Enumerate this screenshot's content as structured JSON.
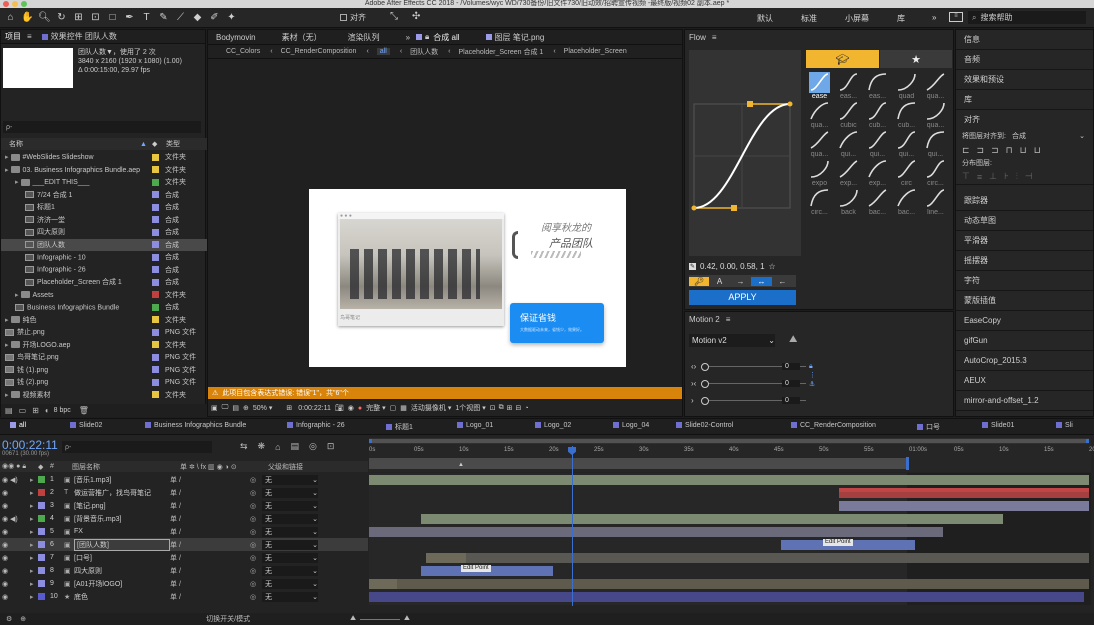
{
  "window": {
    "title": "Adobe After Effects CC 2018 - /Volumes/wyc WD/730备份/旧文件730/旧动效/招聘宣传视频 -最终版/视频02 副本.aep *"
  },
  "toolbar": {
    "align_label": "对齐",
    "workspaces": [
      "默认",
      "标准",
      "小屏幕",
      "库"
    ],
    "more": "»",
    "search_placeholder": "搜索帮助"
  },
  "project": {
    "tab": "项目",
    "effects_tab": "效果控件 团队人数",
    "comp_name": "团队人数▼，使用了 2 次",
    "comp_res": "3840 x 2160 (1920 x 1080) (1.00)",
    "comp_dur": "Δ 0:00:15:00, 29.97 fps",
    "search": "ρ-",
    "col_name": "名称",
    "col_type": "类型",
    "bpc": "8 bpc",
    "rows": [
      {
        "name": "#WebSlides Slideshow",
        "type": "文件夹",
        "color": "#e6c640",
        "kind": "folder",
        "indent": 0
      },
      {
        "name": "03. Business Infographics Bundle.aep",
        "type": "文件夹",
        "color": "#e6c640",
        "kind": "folder",
        "indent": 0
      },
      {
        "name": "___EDIT THIS___",
        "type": "文件夹",
        "color": "#4ea84e",
        "kind": "folder",
        "indent": 1
      },
      {
        "name": "7/24 合成 1",
        "type": "合成",
        "color": "#8d8de0",
        "kind": "comp",
        "indent": 2
      },
      {
        "name": "标题1",
        "type": "合成",
        "color": "#8d8de0",
        "kind": "comp",
        "indent": 2
      },
      {
        "name": "济济一堂",
        "type": "合成",
        "color": "#8d8de0",
        "kind": "comp",
        "indent": 2
      },
      {
        "name": "四大原则",
        "type": "合成",
        "color": "#8d8de0",
        "kind": "comp",
        "indent": 2
      },
      {
        "name": "团队人数",
        "type": "合成",
        "color": "#8d8de0",
        "kind": "comp",
        "indent": 2,
        "selected": true
      },
      {
        "name": "Infographic - 10",
        "type": "合成",
        "color": "#8d8de0",
        "kind": "comp",
        "indent": 2
      },
      {
        "name": "Infographic - 26",
        "type": "合成",
        "color": "#8d8de0",
        "kind": "comp",
        "indent": 2
      },
      {
        "name": "Placeholder_Screen 合成 1",
        "type": "合成",
        "color": "#8d8de0",
        "kind": "comp",
        "indent": 2
      },
      {
        "name": "Assets",
        "type": "文件夹",
        "color": "#c04040",
        "kind": "folder",
        "indent": 1
      },
      {
        "name": "Business Infographics Bundle",
        "type": "合成",
        "color": "#4ea84e",
        "kind": "comp",
        "indent": 1
      },
      {
        "name": "纯色",
        "type": "文件夹",
        "color": "#e6c640",
        "kind": "folder",
        "indent": 0
      },
      {
        "name": "禁止.png",
        "type": "PNG 文件",
        "color": "#8d8de0",
        "kind": "file",
        "indent": 0
      },
      {
        "name": "开场LOGO.aep",
        "type": "文件夹",
        "color": "#e6c640",
        "kind": "folder",
        "indent": 0
      },
      {
        "name": "鸟哥笔记.png",
        "type": "PNG 文件",
        "color": "#8d8de0",
        "kind": "file",
        "indent": 0
      },
      {
        "name": "钱 (1).png",
        "type": "PNG 文件",
        "color": "#8d8de0",
        "kind": "file",
        "indent": 0
      },
      {
        "name": "钱 (2).png",
        "type": "PNG 文件",
        "color": "#8d8de0",
        "kind": "file",
        "indent": 0
      },
      {
        "name": "视频素材",
        "type": "文件夹",
        "color": "#e6c640",
        "kind": "folder",
        "indent": 0
      }
    ]
  },
  "viewer": {
    "tabs": [
      "Bodymovin",
      "素材（无）",
      "渲染队列",
      "合成 all",
      "图层 笔记.png"
    ],
    "breadcrumbs": [
      "CC_Colors",
      "CC_RenderComposition",
      "all",
      "团队人数",
      "Placeholder_Screen 合成 1",
      "Placeholder_Screen"
    ],
    "slide_title": "保证省钱",
    "slide_sub": "大数据驱动未来，省钱少，效果好。",
    "slide_hand1": "阅享秋龙的",
    "slide_hand2": "产品团队",
    "slide_caption": "鸟哥笔记",
    "error": "此项目包含表达式错误: 错误\"1\"，共\"6\"个",
    "zoom": "50%",
    "time": "0:00:22:11",
    "quality": "完整",
    "camera": "活动摄像机",
    "views": "1个视图"
  },
  "flow": {
    "title": "Flow",
    "values": "0.42, 0.00, 0.58, 1",
    "apply": "APPLY",
    "easings": [
      "ease",
      "eas...",
      "eas...",
      "quad",
      "qua...",
      "qua...",
      "cubic",
      "cub...",
      "cub...",
      "qua...",
      "qua...",
      "qui...",
      "qui...",
      "qui...",
      "qui...",
      "expo",
      "exp...",
      "exp...",
      "circ",
      "circ...",
      "circ...",
      "back",
      "bac...",
      "bac...",
      "line..."
    ]
  },
  "motion2": {
    "title": "Motion 2",
    "version": "Motion v2",
    "values": [
      "0",
      "0",
      "0"
    ]
  },
  "right_panel": {
    "items": [
      "信息",
      "音频",
      "效果和预设",
      "库",
      "对齐"
    ],
    "align_to_label": "将图层对齐到:",
    "align_to": "合成",
    "distribute": "分布图层:",
    "plugins": [
      "跟踪器",
      "动态草图",
      "平滑器",
      "摇摆器",
      "字符",
      "蒙版插值",
      "EaseCopy",
      "gifGun",
      "AutoCrop_2015.3",
      "AEUX",
      "mirror-and-offset_1.2"
    ]
  },
  "timeline": {
    "tabs": [
      "all",
      "Slide02",
      "Business Infographics Bundle",
      "Infographic - 26",
      "标题1",
      "Logo_01",
      "Logo_02",
      "Logo_04",
      "Slide02-Control",
      "CC_RenderComposition",
      "口号",
      "Slide01",
      "Sli"
    ],
    "timecode": "0:00:22:11",
    "frames": "00671 (30.00 fps)",
    "col_num": "#",
    "col_name": "图层名称",
    "col_parent": "父级和链接",
    "switch_label": "切换开关/模式",
    "edit_point": "Edit Point",
    "ruler": [
      "0s",
      "05s",
      "10s",
      "15s",
      "20s",
      "25s",
      "30s",
      "35s",
      "40s",
      "45s",
      "50s",
      "55s",
      "01:00s",
      "05s",
      "10s",
      "15s",
      "20s"
    ],
    "layers": [
      {
        "num": "1",
        "name": "[音乐1.mp3]",
        "color": "#4ea84e",
        "parent": "无",
        "kind": "audio"
      },
      {
        "num": "2",
        "name": "做运营推广，找鸟哥笔记",
        "color": "#c04040",
        "parent": "无",
        "kind": "text"
      },
      {
        "num": "3",
        "name": "[笔记.png]",
        "color": "#8d8de0",
        "parent": "无",
        "kind": "file"
      },
      {
        "num": "4",
        "name": "[背景音乐.mp3]",
        "color": "#4ea84e",
        "parent": "无",
        "kind": "audio"
      },
      {
        "num": "5",
        "name": "FX",
        "color": "#8d8de0",
        "parent": "无",
        "kind": "null"
      },
      {
        "num": "6",
        "name": "[团队人数]",
        "color": "#8d8de0",
        "parent": "无",
        "kind": "comp",
        "selected": true
      },
      {
        "num": "7",
        "name": "[口号]",
        "color": "#8d8de0",
        "parent": "无",
        "kind": "comp"
      },
      {
        "num": "8",
        "name": "四大原则",
        "color": "#8d8de0",
        "parent": "无",
        "kind": "comp"
      },
      {
        "num": "9",
        "name": "[A01开场lOGO]",
        "color": "#8d8de0",
        "parent": "无",
        "kind": "comp"
      },
      {
        "num": "10",
        "name": "底色",
        "color": "#5a5ad0",
        "parent": "无",
        "kind": "solid"
      }
    ]
  }
}
